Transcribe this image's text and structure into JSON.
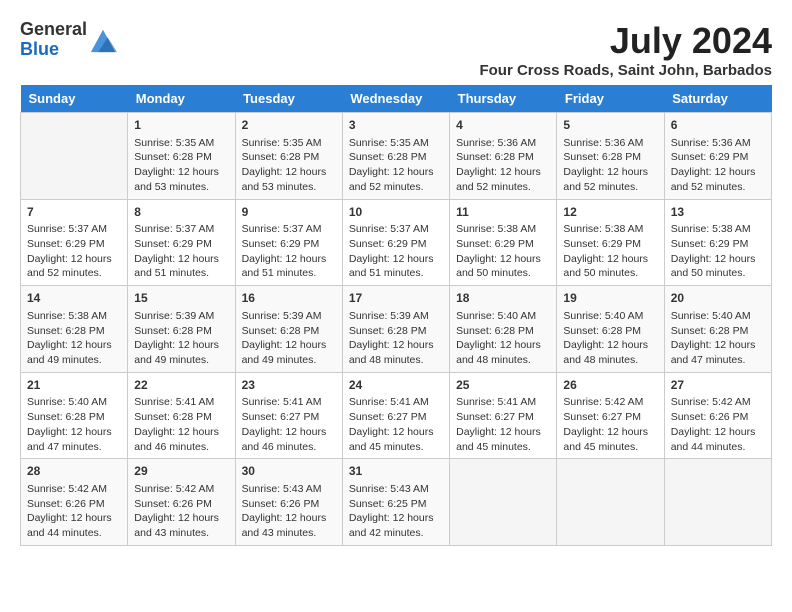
{
  "header": {
    "logo_general": "General",
    "logo_blue": "Blue",
    "month_year": "July 2024",
    "location": "Four Cross Roads, Saint John, Barbados"
  },
  "days_of_week": [
    "Sunday",
    "Monday",
    "Tuesday",
    "Wednesday",
    "Thursday",
    "Friday",
    "Saturday"
  ],
  "weeks": [
    [
      {
        "day": "",
        "sunrise": "",
        "sunset": "",
        "daylight": ""
      },
      {
        "day": "1",
        "sunrise": "Sunrise: 5:35 AM",
        "sunset": "Sunset: 6:28 PM",
        "daylight": "Daylight: 12 hours and 53 minutes."
      },
      {
        "day": "2",
        "sunrise": "Sunrise: 5:35 AM",
        "sunset": "Sunset: 6:28 PM",
        "daylight": "Daylight: 12 hours and 53 minutes."
      },
      {
        "day": "3",
        "sunrise": "Sunrise: 5:35 AM",
        "sunset": "Sunset: 6:28 PM",
        "daylight": "Daylight: 12 hours and 52 minutes."
      },
      {
        "day": "4",
        "sunrise": "Sunrise: 5:36 AM",
        "sunset": "Sunset: 6:28 PM",
        "daylight": "Daylight: 12 hours and 52 minutes."
      },
      {
        "day": "5",
        "sunrise": "Sunrise: 5:36 AM",
        "sunset": "Sunset: 6:28 PM",
        "daylight": "Daylight: 12 hours and 52 minutes."
      },
      {
        "day": "6",
        "sunrise": "Sunrise: 5:36 AM",
        "sunset": "Sunset: 6:29 PM",
        "daylight": "Daylight: 12 hours and 52 minutes."
      }
    ],
    [
      {
        "day": "7",
        "sunrise": "Sunrise: 5:37 AM",
        "sunset": "Sunset: 6:29 PM",
        "daylight": "Daylight: 12 hours and 52 minutes."
      },
      {
        "day": "8",
        "sunrise": "Sunrise: 5:37 AM",
        "sunset": "Sunset: 6:29 PM",
        "daylight": "Daylight: 12 hours and 51 minutes."
      },
      {
        "day": "9",
        "sunrise": "Sunrise: 5:37 AM",
        "sunset": "Sunset: 6:29 PM",
        "daylight": "Daylight: 12 hours and 51 minutes."
      },
      {
        "day": "10",
        "sunrise": "Sunrise: 5:37 AM",
        "sunset": "Sunset: 6:29 PM",
        "daylight": "Daylight: 12 hours and 51 minutes."
      },
      {
        "day": "11",
        "sunrise": "Sunrise: 5:38 AM",
        "sunset": "Sunset: 6:29 PM",
        "daylight": "Daylight: 12 hours and 50 minutes."
      },
      {
        "day": "12",
        "sunrise": "Sunrise: 5:38 AM",
        "sunset": "Sunset: 6:29 PM",
        "daylight": "Daylight: 12 hours and 50 minutes."
      },
      {
        "day": "13",
        "sunrise": "Sunrise: 5:38 AM",
        "sunset": "Sunset: 6:29 PM",
        "daylight": "Daylight: 12 hours and 50 minutes."
      }
    ],
    [
      {
        "day": "14",
        "sunrise": "Sunrise: 5:38 AM",
        "sunset": "Sunset: 6:28 PM",
        "daylight": "Daylight: 12 hours and 49 minutes."
      },
      {
        "day": "15",
        "sunrise": "Sunrise: 5:39 AM",
        "sunset": "Sunset: 6:28 PM",
        "daylight": "Daylight: 12 hours and 49 minutes."
      },
      {
        "day": "16",
        "sunrise": "Sunrise: 5:39 AM",
        "sunset": "Sunset: 6:28 PM",
        "daylight": "Daylight: 12 hours and 49 minutes."
      },
      {
        "day": "17",
        "sunrise": "Sunrise: 5:39 AM",
        "sunset": "Sunset: 6:28 PM",
        "daylight": "Daylight: 12 hours and 48 minutes."
      },
      {
        "day": "18",
        "sunrise": "Sunrise: 5:40 AM",
        "sunset": "Sunset: 6:28 PM",
        "daylight": "Daylight: 12 hours and 48 minutes."
      },
      {
        "day": "19",
        "sunrise": "Sunrise: 5:40 AM",
        "sunset": "Sunset: 6:28 PM",
        "daylight": "Daylight: 12 hours and 48 minutes."
      },
      {
        "day": "20",
        "sunrise": "Sunrise: 5:40 AM",
        "sunset": "Sunset: 6:28 PM",
        "daylight": "Daylight: 12 hours and 47 minutes."
      }
    ],
    [
      {
        "day": "21",
        "sunrise": "Sunrise: 5:40 AM",
        "sunset": "Sunset: 6:28 PM",
        "daylight": "Daylight: 12 hours and 47 minutes."
      },
      {
        "day": "22",
        "sunrise": "Sunrise: 5:41 AM",
        "sunset": "Sunset: 6:28 PM",
        "daylight": "Daylight: 12 hours and 46 minutes."
      },
      {
        "day": "23",
        "sunrise": "Sunrise: 5:41 AM",
        "sunset": "Sunset: 6:27 PM",
        "daylight": "Daylight: 12 hours and 46 minutes."
      },
      {
        "day": "24",
        "sunrise": "Sunrise: 5:41 AM",
        "sunset": "Sunset: 6:27 PM",
        "daylight": "Daylight: 12 hours and 45 minutes."
      },
      {
        "day": "25",
        "sunrise": "Sunrise: 5:41 AM",
        "sunset": "Sunset: 6:27 PM",
        "daylight": "Daylight: 12 hours and 45 minutes."
      },
      {
        "day": "26",
        "sunrise": "Sunrise: 5:42 AM",
        "sunset": "Sunset: 6:27 PM",
        "daylight": "Daylight: 12 hours and 45 minutes."
      },
      {
        "day": "27",
        "sunrise": "Sunrise: 5:42 AM",
        "sunset": "Sunset: 6:26 PM",
        "daylight": "Daylight: 12 hours and 44 minutes."
      }
    ],
    [
      {
        "day": "28",
        "sunrise": "Sunrise: 5:42 AM",
        "sunset": "Sunset: 6:26 PM",
        "daylight": "Daylight: 12 hours and 44 minutes."
      },
      {
        "day": "29",
        "sunrise": "Sunrise: 5:42 AM",
        "sunset": "Sunset: 6:26 PM",
        "daylight": "Daylight: 12 hours and 43 minutes."
      },
      {
        "day": "30",
        "sunrise": "Sunrise: 5:43 AM",
        "sunset": "Sunset: 6:26 PM",
        "daylight": "Daylight: 12 hours and 43 minutes."
      },
      {
        "day": "31",
        "sunrise": "Sunrise: 5:43 AM",
        "sunset": "Sunset: 6:25 PM",
        "daylight": "Daylight: 12 hours and 42 minutes."
      },
      {
        "day": "",
        "sunrise": "",
        "sunset": "",
        "daylight": ""
      },
      {
        "day": "",
        "sunrise": "",
        "sunset": "",
        "daylight": ""
      },
      {
        "day": "",
        "sunrise": "",
        "sunset": "",
        "daylight": ""
      }
    ]
  ]
}
